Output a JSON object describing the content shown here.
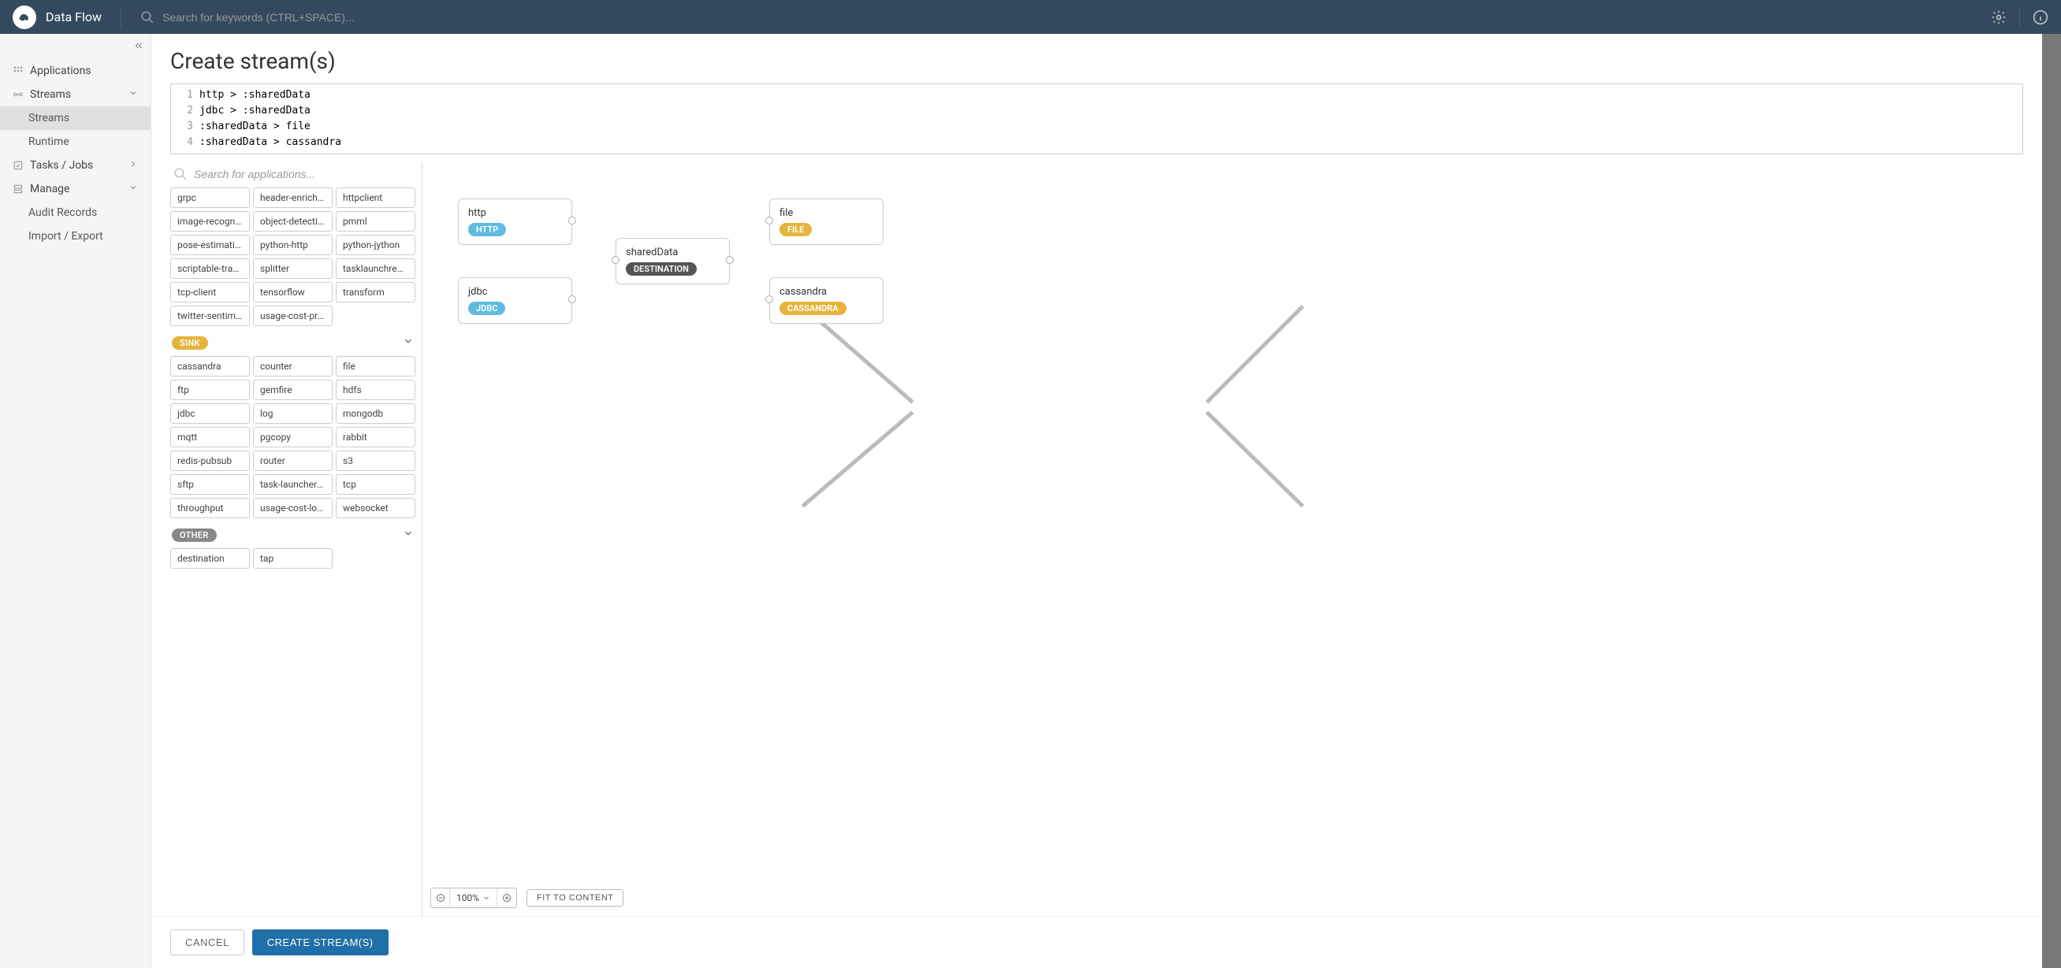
{
  "header": {
    "brand": "Data Flow",
    "search_placeholder": "Search for keywords (CTRL+SPACE)..."
  },
  "sidebar": {
    "items": [
      {
        "label": "Applications",
        "icon": "grid-icon"
      },
      {
        "label": "Streams",
        "icon": "stream-icon",
        "expanded": true,
        "children": [
          {
            "label": "Streams",
            "active": true
          },
          {
            "label": "Runtime"
          }
        ]
      },
      {
        "label": "Tasks / Jobs",
        "icon": "task-icon"
      },
      {
        "label": "Manage",
        "icon": "manage-icon",
        "expanded": true,
        "children": [
          {
            "label": "Audit Records"
          },
          {
            "label": "Import / Export"
          }
        ]
      }
    ]
  },
  "page": {
    "title": "Create stream(s)"
  },
  "editor": {
    "lines": [
      "http > :sharedData",
      "jdbc > :sharedData",
      ":sharedData > file",
      ":sharedData > cassandra"
    ]
  },
  "palette": {
    "search_placeholder": "Search for applications...",
    "processors": [
      "grpc",
      "header-enricher",
      "httpclient",
      "image-recogniti...",
      "object-detection",
      "pmml",
      "pose-estimation",
      "python-http",
      "python-jython",
      "scriptable-transf...",
      "splitter",
      "tasklaunchreque...",
      "tcp-client",
      "tensorflow",
      "transform",
      "twitter-sentiment",
      "usage-cost-proc..."
    ],
    "sink_label": "SINK",
    "sinks": [
      "cassandra",
      "counter",
      "file",
      "ftp",
      "gemfire",
      "hdfs",
      "jdbc",
      "log",
      "mongodb",
      "mqtt",
      "pgcopy",
      "rabbit",
      "redis-pubsub",
      "router",
      "s3",
      "sftp",
      "task-launcher-d...",
      "tcp",
      "throughput",
      "usage-cost-logg...",
      "websocket"
    ],
    "other_label": "OTHER",
    "others": [
      "destination",
      "tap"
    ]
  },
  "canvas": {
    "nodes": {
      "http": {
        "title": "http",
        "badge": "HTTP",
        "cls": "http"
      },
      "jdbc": {
        "title": "jdbc",
        "badge": "JDBC",
        "cls": "jdbc"
      },
      "shared": {
        "title": "sharedData",
        "badge": "DESTINATION",
        "cls": "dest"
      },
      "file": {
        "title": "file",
        "badge": "FILE",
        "cls": "file"
      },
      "cassandra": {
        "title": "cassandra",
        "badge": "CASSANDRA",
        "cls": "cassandra"
      }
    },
    "zoom": "100%",
    "fit_label": "FIT TO CONTENT"
  },
  "footer": {
    "cancel": "CANCEL",
    "create": "CREATE STREAM(S)"
  }
}
